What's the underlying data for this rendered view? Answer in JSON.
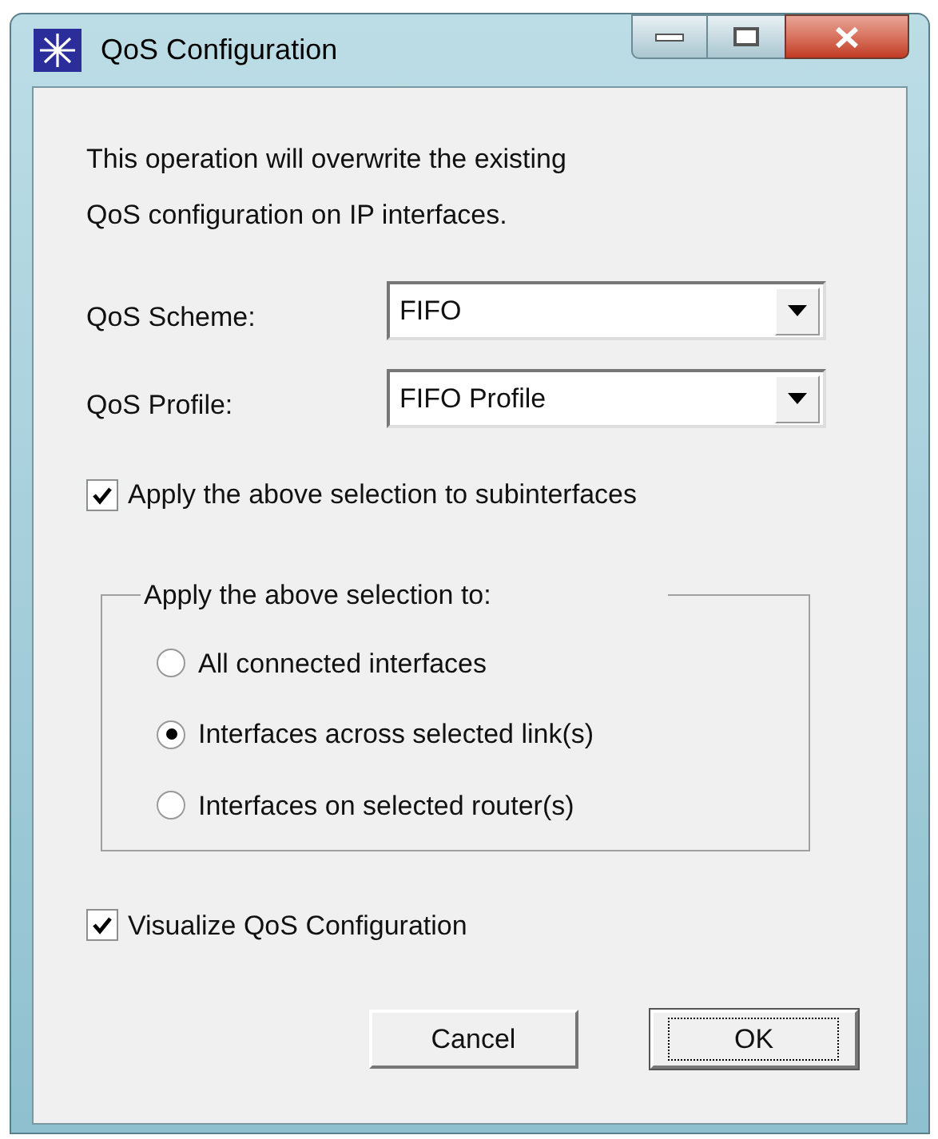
{
  "window": {
    "title": "QoS Configuration"
  },
  "message": [
    "This operation will overwrite the existing",
    "QoS configuration on IP interfaces."
  ],
  "fields": [
    {
      "label": "QoS Scheme:",
      "value": "FIFO"
    },
    {
      "label": "QoS Profile:",
      "value": "FIFO Profile"
    }
  ],
  "subinterfaces": {
    "label": "Apply the above selection to subinterfaces",
    "checked": true
  },
  "group": {
    "title": "Apply the above selection to:",
    "options": [
      {
        "label": "All connected interfaces",
        "selected": false
      },
      {
        "label": "Interfaces across selected link(s)",
        "selected": true
      },
      {
        "label": "Interfaces on selected router(s)",
        "selected": false
      }
    ]
  },
  "visualize": {
    "label": "Visualize QoS Configuration",
    "checked": true
  },
  "buttons": [
    {
      "label": "Cancel",
      "default": false
    },
    {
      "label": "OK",
      "default": true
    }
  ]
}
